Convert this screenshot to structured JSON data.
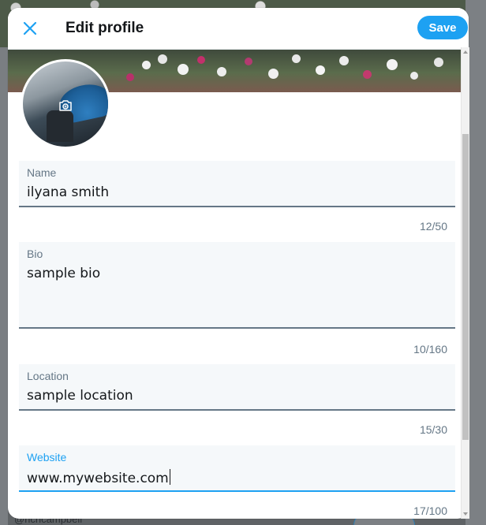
{
  "dialog": {
    "title": "Edit profile",
    "save_label": "Save"
  },
  "fields": {
    "name": {
      "label": "Name",
      "value": "ilyana smith",
      "counter": "12/50"
    },
    "bio": {
      "label": "Bio",
      "value": "sample bio",
      "counter": "10/160"
    },
    "location": {
      "label": "Location",
      "value": "sample location",
      "counter": "15/30"
    },
    "website": {
      "label": "Website",
      "value": "www.mywebsite.com",
      "counter": "17/100"
    }
  },
  "background": {
    "handle": "@richcampbell"
  },
  "colors": {
    "accent": "#1da1f2",
    "label": "#657786",
    "field_bg": "#f5f8fa",
    "text": "#14171a"
  },
  "icons": {
    "close": "close-icon",
    "camera": "camera-icon"
  }
}
